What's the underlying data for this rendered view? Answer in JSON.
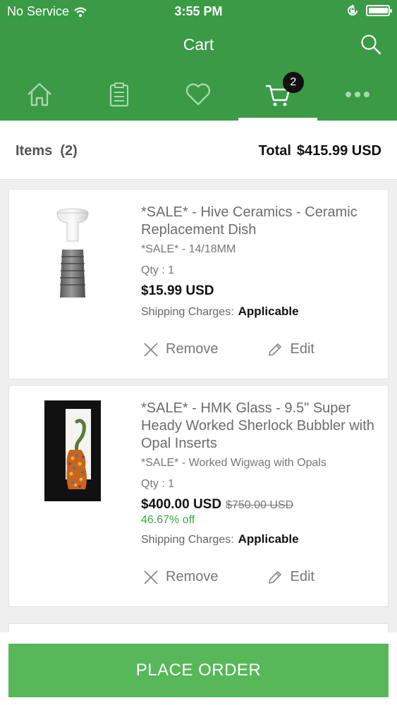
{
  "status": {
    "carrier": "No Service",
    "time": "3:55 PM",
    "battery_level": 0.9
  },
  "header": {
    "title": "Cart",
    "search_icon": "search-icon"
  },
  "tabs": [
    {
      "icon": "home-icon",
      "active": false
    },
    {
      "icon": "clipboard-icon",
      "active": false
    },
    {
      "icon": "heart-icon",
      "active": false
    },
    {
      "icon": "cart-icon",
      "active": true,
      "badge": "2"
    },
    {
      "icon": "more-icon",
      "active": false
    }
  ],
  "summary": {
    "items_label": "Items",
    "items_count": "(2)",
    "total_label": "Total",
    "total_value": "$415.99 USD"
  },
  "products": [
    {
      "title": "*SALE* - Hive Ceramics - Ceramic Replacement Dish",
      "variant": "*SALE* - 14/18MM",
      "qty": "Qty : 1",
      "price": "$15.99 USD",
      "shipping_label": "Shipping Charges:",
      "shipping_value": "Applicable",
      "remove_label": "Remove",
      "edit_label": "Edit"
    },
    {
      "title": "*SALE* - HMK Glass - 9.5\" Super Heady Worked Sherlock Bubbler with Opal Inserts",
      "variant": "*SALE* - Worked Wigwag with Opals",
      "qty": "Qty : 1",
      "price": "$400.00 USD",
      "original_price": "$750.00 USD",
      "discount": "46.67% off",
      "shipping_label": "Shipping Charges:",
      "shipping_value": "Applicable",
      "remove_label": "Remove",
      "edit_label": "Edit"
    }
  ],
  "footer": {
    "place_order_label": "PLACE ORDER"
  },
  "colors": {
    "brand_green": "#3a9a45",
    "button_green": "#57b759",
    "discount_green": "#3aa73e"
  }
}
